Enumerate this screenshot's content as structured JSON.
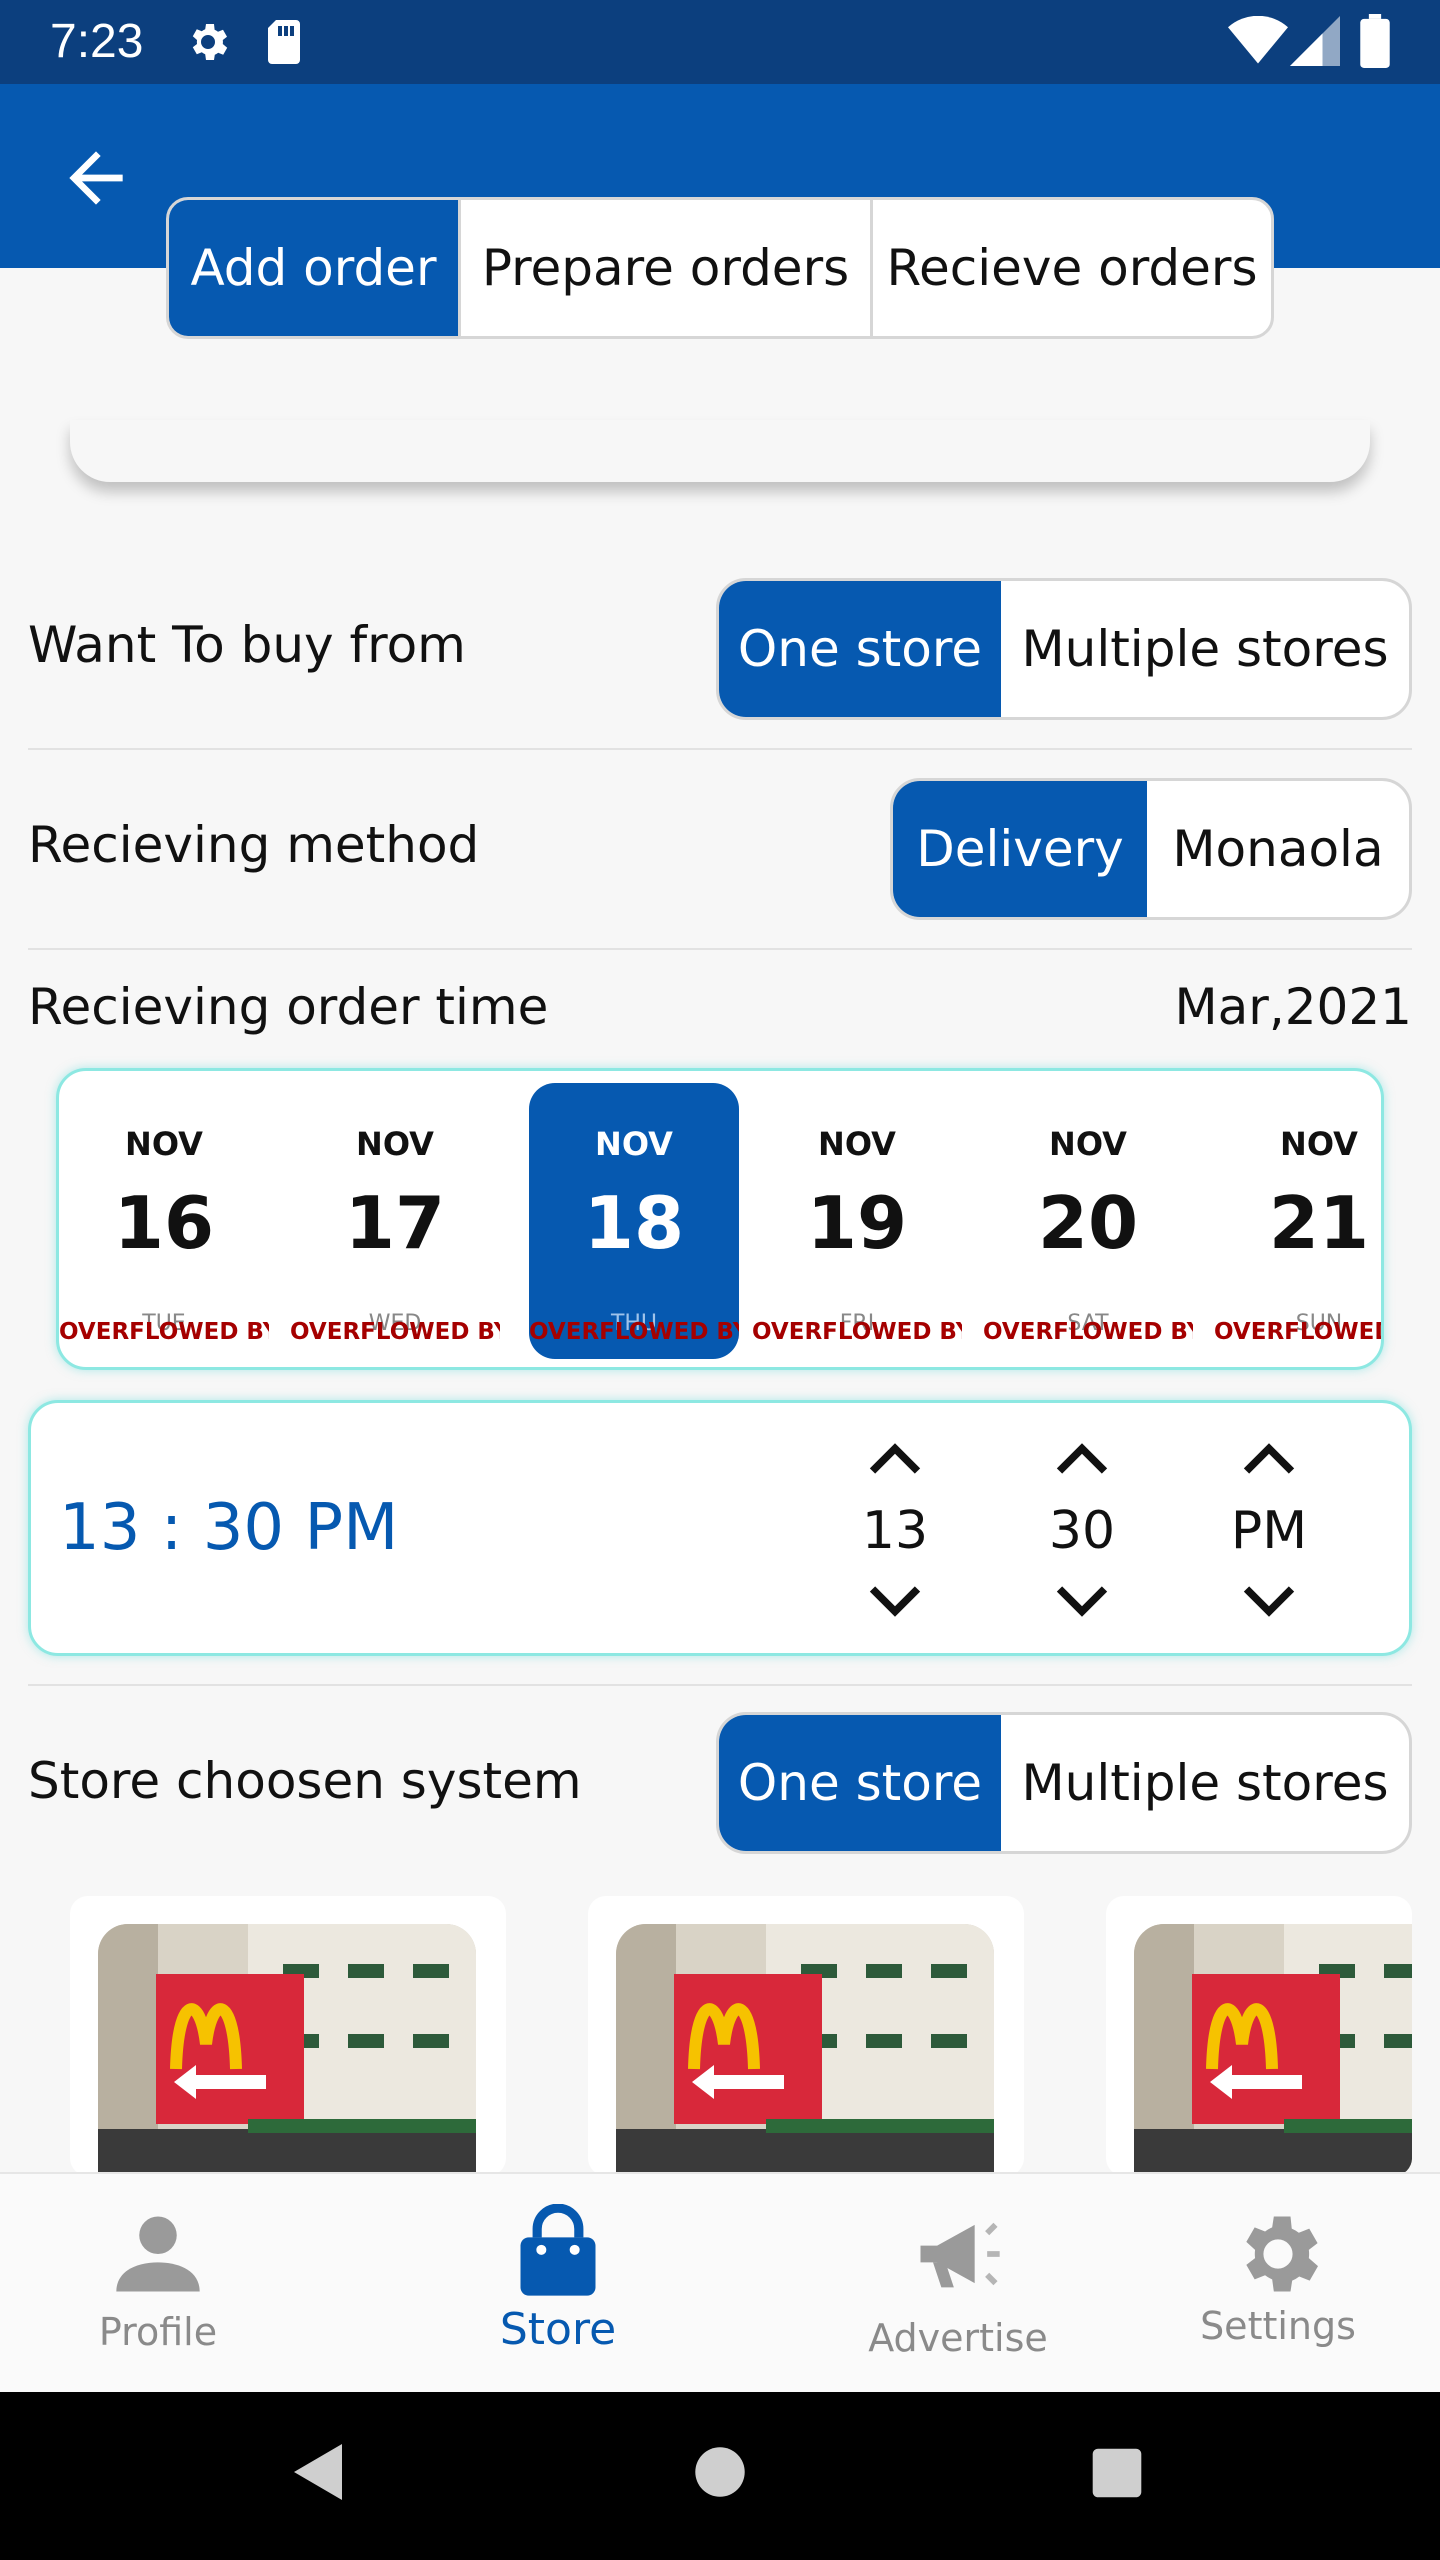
{
  "status_bar": {
    "time": "7:23"
  },
  "tabs": [
    {
      "label": "Add order",
      "active": true
    },
    {
      "label": "Prepare orders",
      "active": false
    },
    {
      "label": "Recieve orders",
      "active": false
    }
  ],
  "buy_from": {
    "label": "Want To buy from",
    "options": [
      {
        "label": "One store",
        "active": true
      },
      {
        "label": "Multiple stores",
        "active": false
      }
    ]
  },
  "receiving_method": {
    "label": "Recieving method",
    "options": [
      {
        "label": "Delivery",
        "active": true
      },
      {
        "label": "Monaola",
        "active": false
      }
    ]
  },
  "receiving_time": {
    "label": "Recieving order time",
    "month": "Mar,2021"
  },
  "dates": [
    {
      "month": "NOV",
      "day": "16",
      "weekday": "TUE",
      "overflow": "OVERFLOWED BY BOTTOM"
    },
    {
      "month": "NOV",
      "day": "17",
      "weekday": "WED",
      "overflow": "OVERFLOWED BY BOTTOM"
    },
    {
      "month": "NOV",
      "day": "18",
      "weekday": "THU",
      "overflow": "OVERFLOWED BY BOTTOM",
      "selected": true
    },
    {
      "month": "NOV",
      "day": "19",
      "weekday": "FRI",
      "overflow": "OVERFLOWED BY BOTTOM"
    },
    {
      "month": "NOV",
      "day": "20",
      "weekday": "SAT",
      "overflow": "OVERFLOWED BY BOTTOM"
    },
    {
      "month": "NOV",
      "day": "21",
      "weekday": "SUN",
      "overflow": "OVERFLOWED"
    }
  ],
  "time_picker": {
    "display": "13 : 30 PM",
    "hour": "13",
    "minute": "30",
    "period": "PM"
  },
  "store_system": {
    "label": "Store choosen system",
    "options": [
      {
        "label": "One store",
        "active": true
      },
      {
        "label": "Multiple stores",
        "active": false
      }
    ]
  },
  "bottom_nav": [
    {
      "label": "Profile",
      "icon": "person-icon",
      "active": false
    },
    {
      "label": "Store",
      "icon": "shopping-bag-icon",
      "active": true
    },
    {
      "label": "Advertise",
      "icon": "megaphone-icon",
      "active": false
    },
    {
      "label": "Settings",
      "icon": "gear-icon",
      "active": false
    }
  ],
  "colors": {
    "primary": "#0659b0",
    "status_bar": "#0c3f7e",
    "overflow_warning": "#a50000",
    "accent_border": "#8de8e2"
  }
}
